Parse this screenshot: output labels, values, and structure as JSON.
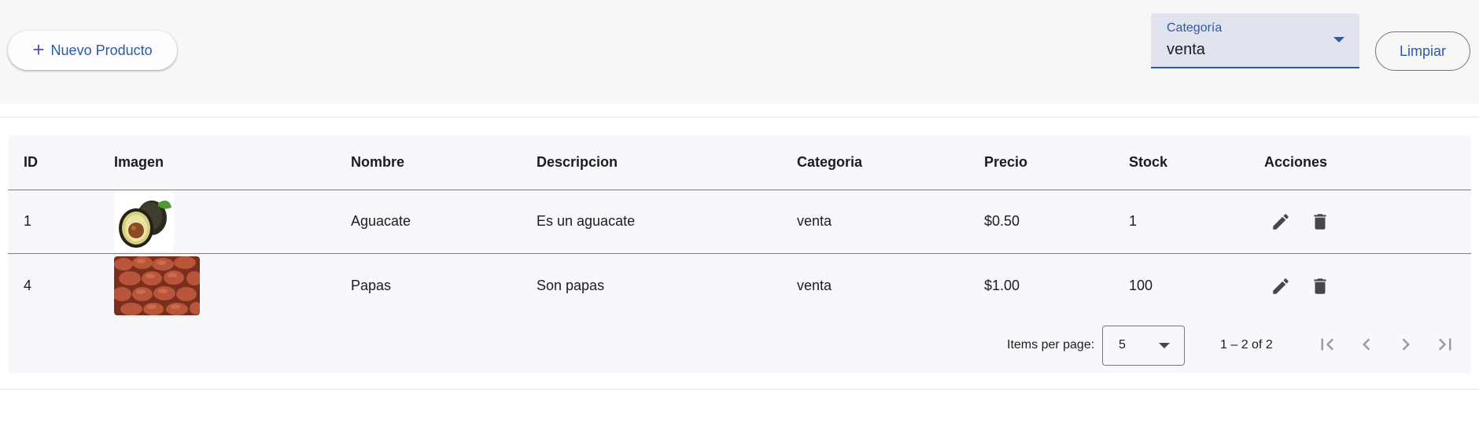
{
  "toolbar": {
    "new_button_label": "Nuevo Producto",
    "category_select": {
      "label": "Categoría",
      "value": "venta"
    },
    "clear_button_label": "Limpiar"
  },
  "table": {
    "columns": [
      "ID",
      "Imagen",
      "Nombre",
      "Descripcion",
      "Categoria",
      "Precio",
      "Stock",
      "Acciones"
    ],
    "rows": [
      {
        "id": "1",
        "image": "avocado-image",
        "name": "Aguacate",
        "description": "Es un aguacate",
        "category": "venta",
        "price": "$0.50",
        "stock": "1"
      },
      {
        "id": "4",
        "image": "potatoes-image",
        "name": "Papas",
        "description": "Son papas",
        "category": "venta",
        "price": "$1.00",
        "stock": "100"
      }
    ]
  },
  "paginator": {
    "items_per_page_label": "Items per page:",
    "page_size": "5",
    "range_label": "1 – 2 of 2"
  },
  "icons": {
    "add": "plus-icon",
    "edit": "pencil-icon",
    "delete": "trash-icon",
    "first": "first-page-icon",
    "prev": "chevron-left-icon",
    "next": "chevron-right-icon",
    "last": "last-page-icon"
  },
  "colors": {
    "primary": "#2b5aa8",
    "icon": "#44474f",
    "card_bg": "#f8f8fc"
  }
}
